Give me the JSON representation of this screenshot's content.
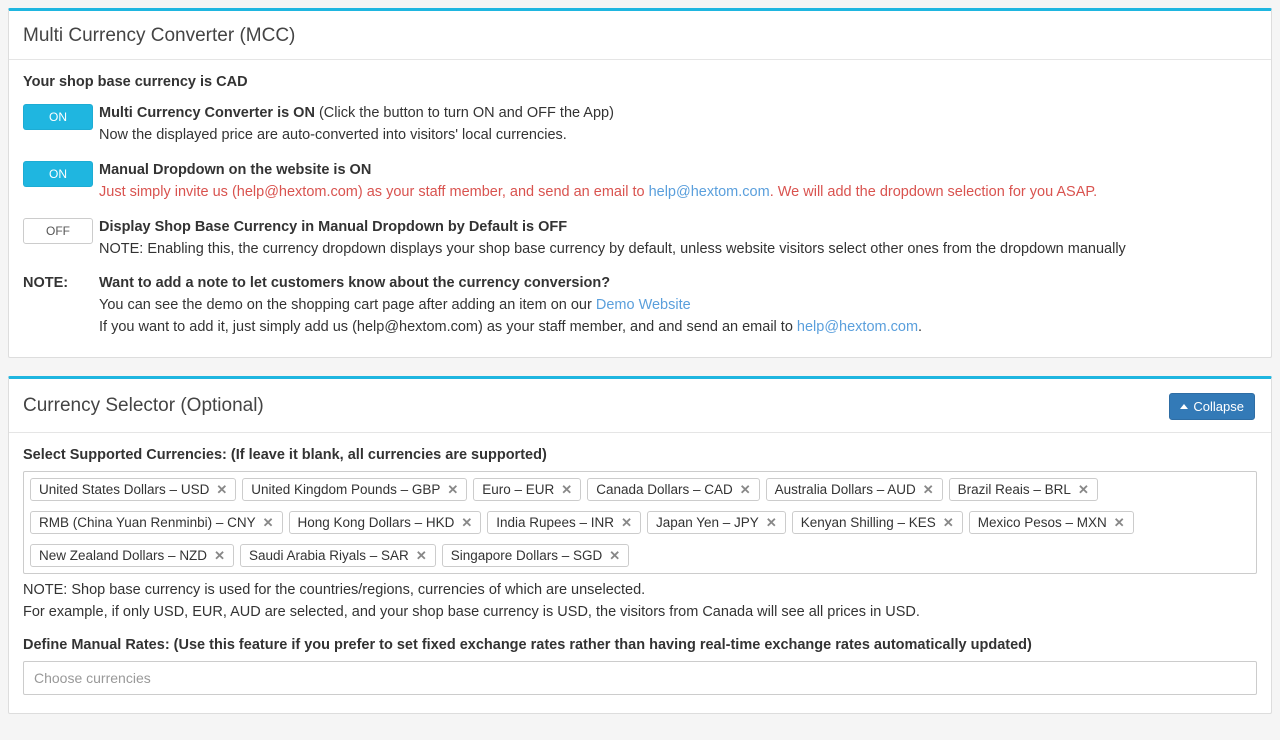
{
  "panel1": {
    "title": "Multi Currency Converter (MCC)",
    "base_line": "Your shop base currency is CAD",
    "rows": {
      "app": {
        "toggle": "ON",
        "title_strong": "Multi Currency Converter is ON",
        "title_rest": " (Click the button to turn ON and OFF the App)",
        "desc": "Now the displayed price are auto-converted into visitors' local currencies."
      },
      "dropdown": {
        "toggle": "ON",
        "title_strong": "Manual Dropdown on the website is ON",
        "desc_pre": "Just simply invite us (help@hextom.com) as your staff member, and send an email to ",
        "desc_link": "help@hextom.com",
        "desc_mid": ". ",
        "desc_post": "We will add the dropdown selection for you ASAP."
      },
      "display_base": {
        "toggle": "OFF",
        "title_strong": "Display Shop Base Currency in Manual Dropdown by Default is OFF",
        "desc": "NOTE: Enabling this, the currency dropdown displays your shop base currency by default, unless website visitors select other ones from the dropdown manually"
      },
      "note": {
        "label": "NOTE:",
        "title_strong": "Want to add a note to let customers know about the currency conversion?",
        "line1_pre": "You can see the demo on the shopping cart page after adding an item on our ",
        "line1_link": "Demo Website",
        "line2_pre": "If you want to add it, just simply add us (help@hextom.com) as your staff member, and and send an email to ",
        "line2_link": "help@hextom.com",
        "line2_post": "."
      }
    }
  },
  "panel2": {
    "title": "Currency Selector (Optional)",
    "collapse_label": "Collapse",
    "supported_label": "Select Supported Currencies: (If leave it blank, all currencies are supported)",
    "currencies": [
      "United States Dollars – USD",
      "United Kingdom Pounds – GBP",
      "Euro – EUR",
      "Canada Dollars – CAD",
      "Australia Dollars – AUD",
      "Brazil Reais – BRL",
      "RMB (China Yuan Renminbi) – CNY",
      "Hong Kong Dollars – HKD",
      "India Rupees – INR",
      "Japan Yen – JPY",
      "Kenyan Shilling – KES",
      "Mexico Pesos – MXN",
      "New Zealand Dollars – NZD",
      "Saudi Arabia Riyals – SAR",
      "Singapore Dollars – SGD"
    ],
    "note1": "NOTE: Shop base currency is used for the countries/regions, currencies of which are unselected.",
    "note2": "For example, if only USD, EUR, AUD are selected, and your shop base currency is USD, the visitors from Canada will see all prices in USD.",
    "manual_rates_label": "Define Manual Rates: (Use this feature if you prefer to set fixed exchange rates rather than having real-time exchange rates automatically updated)",
    "choose_placeholder": "Choose currencies"
  }
}
